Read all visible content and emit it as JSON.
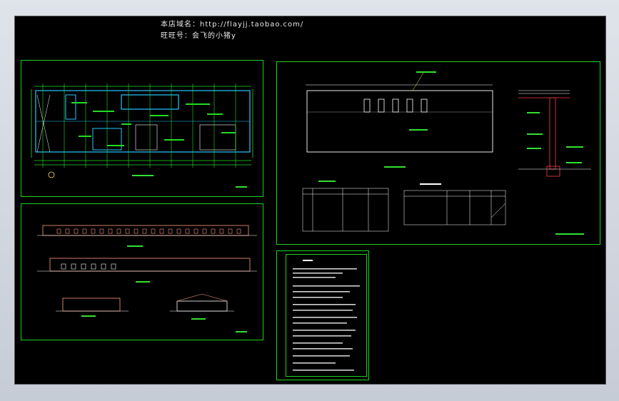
{
  "window": {
    "background_color": "#000000",
    "frame_color": "#1fd11f"
  },
  "watermark": {
    "shop_line": "本店域名：http://flayjj.taobao.com/",
    "wangwang_line": "旺旺号：会飞的小猪y"
  },
  "sheets": {
    "floor_plan": {
      "name": "plan-sheet"
    },
    "elevations": {
      "name": "elevation-sheet"
    },
    "roof_plan": {
      "name": "roof-sheet"
    },
    "design_notes": {
      "name": "notes-sheet"
    }
  },
  "colors": {
    "wall": "#27c6ff",
    "dim": "#22dd22",
    "detail": "#ff3b3b",
    "text": "#e0e0e0",
    "elev": "#ff9a7a",
    "yellow": "#ffe14a"
  }
}
